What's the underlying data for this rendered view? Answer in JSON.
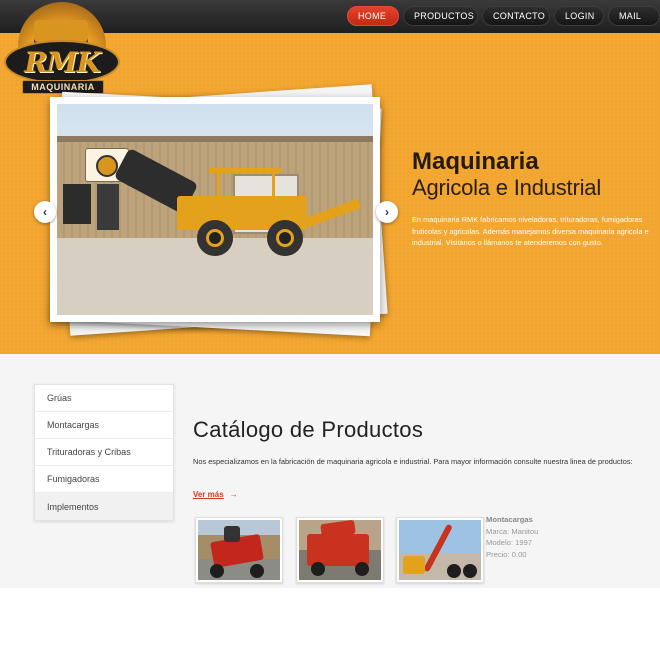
{
  "nav": {
    "items": [
      {
        "label": "HOME",
        "active": true
      },
      {
        "label": "PRODUCTOS",
        "active": false
      },
      {
        "label": "CONTACTO",
        "active": false
      },
      {
        "label": "LOGIN",
        "active": false
      },
      {
        "label": "MAIL",
        "active": false
      }
    ]
  },
  "logo": {
    "text": "RMK",
    "subtext": "MAQUINARIA"
  },
  "hero": {
    "title": "Maquinaria",
    "subtitle": "Agricola e Industrial",
    "text": "En maquinaria RMK fabricamos niveladoras, trituradoras, fumigadoras fruticolas y agricolas. Además manejamos diversa maquinaria agricola e industrial. Visitanos o llámanos te atenderemos con gusto.",
    "arrow_left": "‹",
    "arrow_right": "›"
  },
  "sidebar": {
    "items": [
      {
        "label": "Grúas"
      },
      {
        "label": "Montacargas"
      },
      {
        "label": "Trituradoras y Cribas"
      },
      {
        "label": "Fumigadoras"
      },
      {
        "label": "Implementos"
      }
    ]
  },
  "catalog": {
    "title": "Catálogo de Productos",
    "description": "Nos especializamos en la fabricación de maquinaria agricola e industrial. Para mayor información consulte nuestra linea de productos:",
    "more_label": "Ver más",
    "more_arrow": "→"
  },
  "product": {
    "name": "Montacargas",
    "brand": "Marca: Manitou",
    "model": "Modelo: 1997",
    "price": "Precio: 0.00"
  },
  "colors": {
    "hero_bg": "#f2a52f",
    "nav_active": "#d4391f",
    "accent_link": "#d4391f"
  }
}
